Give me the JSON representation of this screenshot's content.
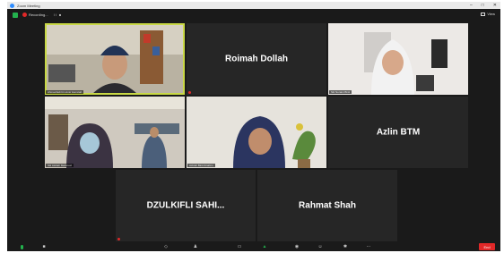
{
  "titlebar": {
    "title": "Zoom Meeting",
    "min": "–",
    "max": "□",
    "close": "✕"
  },
  "topbar": {
    "recording_label": "Recording...",
    "recording_controls": "II ■",
    "view_label": "View"
  },
  "participants": [
    {
      "tile_name": "",
      "name_tag": "Ahmad Edi bin Amir Hamzah"
    },
    {
      "tile_name": "Roimah Dollah",
      "name_tag": ""
    },
    {
      "tile_name": "",
      "name_tag": "Siti Noraini Binti"
    },
    {
      "tile_name": "",
      "name_tag": "Siti Aishah Mahmud"
    },
    {
      "tile_name": "",
      "name_tag": "Azizah Binti Ibrahim"
    },
    {
      "tile_name": "Azlin BTM",
      "name_tag": ""
    },
    {
      "tile_name": "DZULKIFLI SAHI...",
      "name_tag": ""
    },
    {
      "tile_name": "Rahmat Shah",
      "name_tag": ""
    }
  ],
  "toolbar": {
    "end_label": "End"
  },
  "colors": {
    "active_speaker": "#c8d845",
    "end": "#e02828",
    "secure": "#23b14d"
  }
}
